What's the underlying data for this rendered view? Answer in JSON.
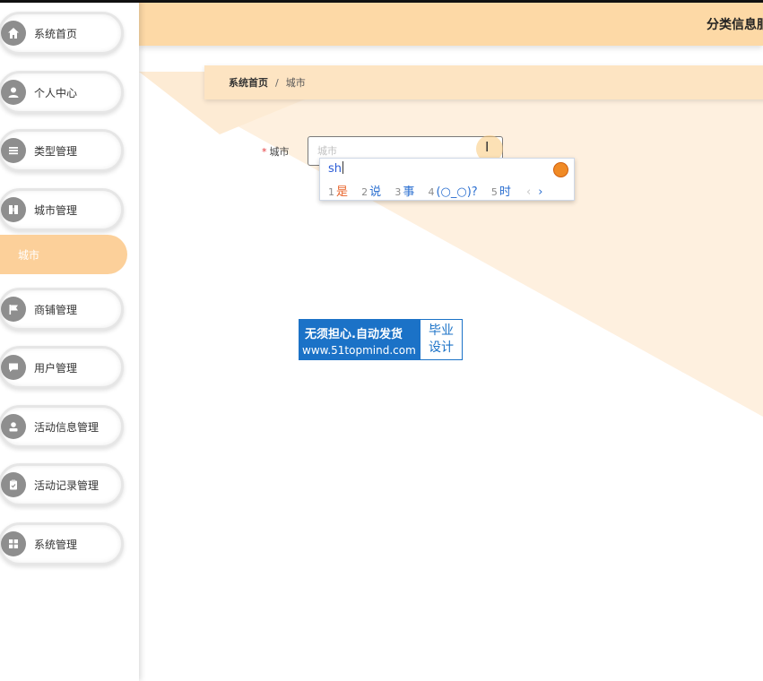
{
  "header": {
    "title": "分类信息服"
  },
  "sidebar": {
    "items": [
      {
        "label": "系统首页",
        "icon": "home-icon"
      },
      {
        "label": "个人中心",
        "icon": "user-icon"
      },
      {
        "label": "类型管理",
        "icon": "list-icon"
      },
      {
        "label": "城市管理",
        "icon": "book-icon"
      },
      {
        "label": "商铺管理",
        "icon": "flag-icon"
      },
      {
        "label": "用户管理",
        "icon": "chat-icon"
      },
      {
        "label": "活动信息管理",
        "icon": "person-icon"
      },
      {
        "label": "活动记录管理",
        "icon": "clipboard-icon"
      },
      {
        "label": "系统管理",
        "icon": "grid-icon"
      }
    ],
    "active_sub": "城市"
  },
  "breadcrumb": {
    "home": "系统首页",
    "separator": "/",
    "current": "城市"
  },
  "form": {
    "required_mark": "*",
    "city_label": "城市",
    "city_placeholder": "城市",
    "city_value": ""
  },
  "ime": {
    "composition": "sh",
    "candidates": [
      {
        "num": "1",
        "text": "是"
      },
      {
        "num": "2",
        "text": "说"
      },
      {
        "num": "3",
        "text": "事"
      },
      {
        "num": "4",
        "text": "(○_○)?"
      },
      {
        "num": "5",
        "text": "时"
      }
    ],
    "prev": "‹",
    "next": "›"
  },
  "watermark": {
    "line1": "无须担心.自动发货",
    "line2": "www.51topmind.com",
    "badge_line1": "毕业",
    "badge_line2": "设计"
  },
  "colors": {
    "accent": "#fdd9a6",
    "active_sub": "#fcd09a",
    "watermark_blue": "#1b72c7",
    "ime_blue": "#2b6fd0",
    "ime_first": "#e8632a"
  }
}
